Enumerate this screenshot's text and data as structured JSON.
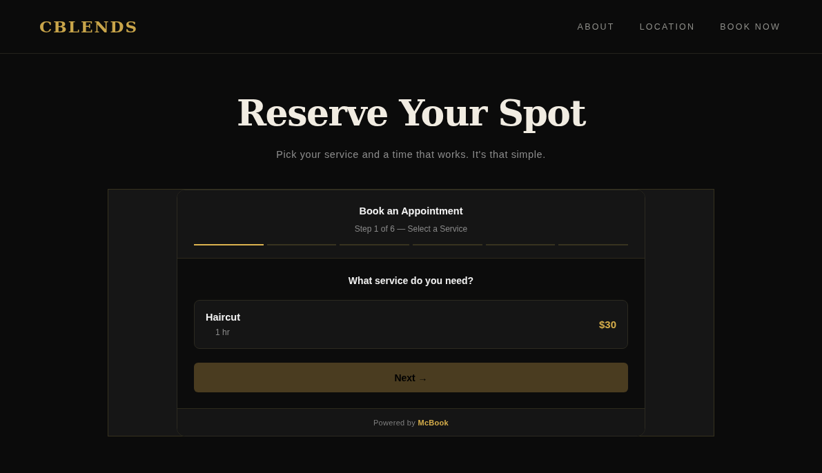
{
  "header": {
    "logo": "CBLENDS",
    "nav": [
      "ABOUT",
      "LOCATION",
      "BOOK NOW"
    ]
  },
  "hero": {
    "title": "Reserve Your Spot",
    "subtitle": "Pick your service and a time that works. It's that simple."
  },
  "booking": {
    "title": "Book an Appointment",
    "step_label": "Step 1 of 6 — Select a Service",
    "steps": [
      {
        "active": true
      },
      {
        "active": false
      },
      {
        "active": false
      },
      {
        "active": false
      },
      {
        "active": false
      },
      {
        "active": false
      }
    ],
    "question": "What service do you need?",
    "services": [
      {
        "name": "Haircut",
        "duration": "1 hr",
        "price": "$30",
        "selected": false
      }
    ],
    "next_button": {
      "label": "Next →",
      "disabled": true
    },
    "footer": "Powered by **McBook**"
  }
}
